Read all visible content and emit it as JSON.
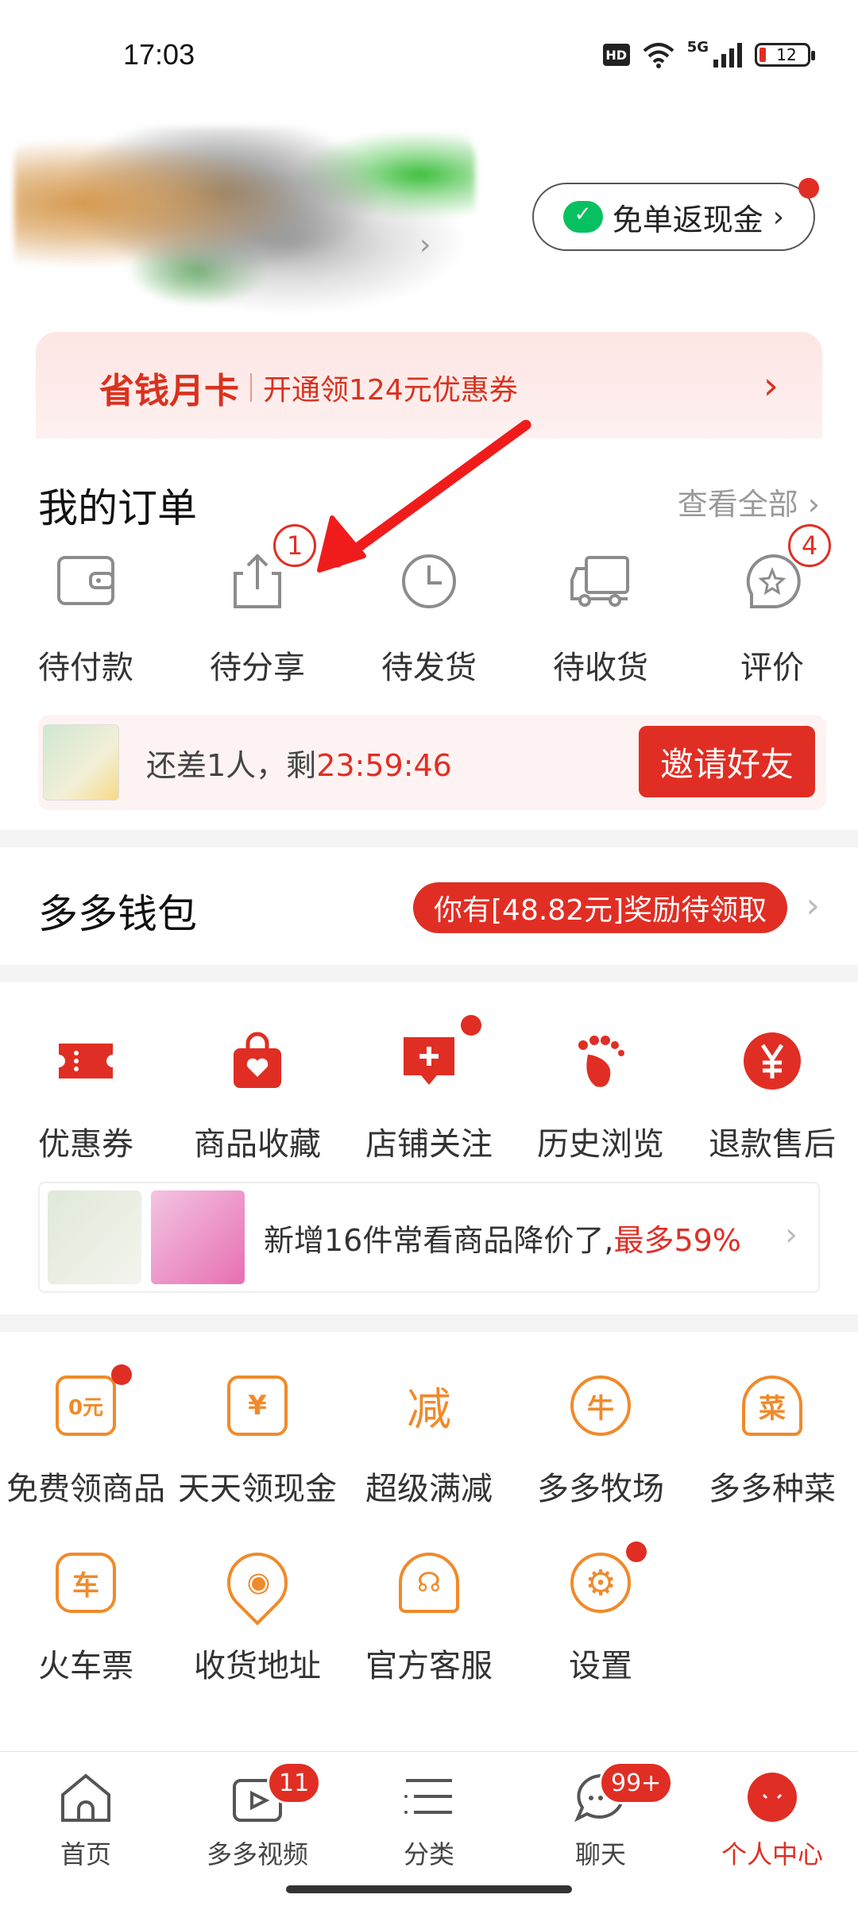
{
  "status_bar": {
    "time": "17:03",
    "hd": "HD",
    "network": "5G",
    "battery": "12"
  },
  "profile": {
    "cashback_label": "免单返现金"
  },
  "monthly_card": {
    "title": "省钱月卡",
    "subtitle": "开通领124元优惠券"
  },
  "orders": {
    "title": "我的订单",
    "view_all": "查看全部",
    "items": [
      {
        "label": "待付款",
        "icon": "wallet-icon"
      },
      {
        "label": "待分享",
        "icon": "share-icon",
        "badge": "1"
      },
      {
        "label": "待发货",
        "icon": "clock-icon"
      },
      {
        "label": "待收货",
        "icon": "truck-icon"
      },
      {
        "label": "评价",
        "icon": "review-icon",
        "badge": "4"
      }
    ],
    "share_strip": {
      "text": "还差1人，剩",
      "timer": "23:59:46",
      "button": "邀请好友"
    }
  },
  "wallet": {
    "title": "多多钱包",
    "reward": "你有[48.82元]奖励待领取"
  },
  "tools": {
    "items": [
      {
        "label": "优惠券",
        "icon": "coupon-icon"
      },
      {
        "label": "商品收藏",
        "icon": "bag-heart-icon"
      },
      {
        "label": "店铺关注",
        "icon": "shop-follow-icon"
      },
      {
        "label": "历史浏览",
        "icon": "footprint-icon"
      },
      {
        "label": "退款售后",
        "icon": "yen-icon"
      }
    ],
    "price_drop": {
      "text": "新增16件常看商品降价了,",
      "highlight": "最多59%"
    }
  },
  "services": {
    "items": [
      {
        "label": "免费领商品",
        "icon": "free-item-icon",
        "glyph": "0元"
      },
      {
        "label": "天天领现金",
        "icon": "cash-icon",
        "glyph": "¥"
      },
      {
        "label": "超级满减",
        "icon": "discount-icon",
        "glyph": "减"
      },
      {
        "label": "多多牧场",
        "icon": "cow-icon",
        "glyph": "牛"
      },
      {
        "label": "多多种菜",
        "icon": "chef-icon",
        "glyph": "菜"
      },
      {
        "label": "火车票",
        "icon": "train-icon",
        "glyph": "车"
      },
      {
        "label": "收货地址",
        "icon": "location-icon",
        "glyph": "◉"
      },
      {
        "label": "官方客服",
        "icon": "headset-icon",
        "glyph": "☊"
      },
      {
        "label": "设置",
        "icon": "gear-icon",
        "glyph": "⚙"
      }
    ]
  },
  "bottom_nav": {
    "items": [
      {
        "label": "首页",
        "icon": "home-icon"
      },
      {
        "label": "多多视频",
        "icon": "video-icon",
        "badge": "11"
      },
      {
        "label": "分类",
        "icon": "category-icon"
      },
      {
        "label": "聊天",
        "icon": "chat-icon",
        "badge": "99+"
      },
      {
        "label": "个人中心",
        "icon": "profile-icon"
      }
    ]
  },
  "colors": {
    "accent": "#e02e24",
    "orange": "#f08a2a",
    "monthly_bg": "#fde6e4"
  }
}
